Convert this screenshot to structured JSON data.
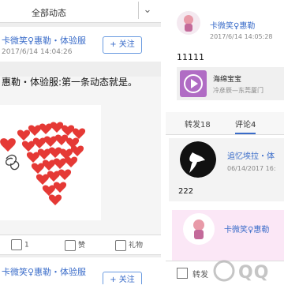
{
  "left": {
    "filter_label": "全部动态",
    "post1": {
      "user": "卡微笑♀惠勒・体验服",
      "time": "2017/6/14 14:04:26",
      "follow": "+ 关注",
      "text": "惠勒・体验服:第一条动态就是。",
      "actions": {
        "comments": "1",
        "like": "赞",
        "gift": "礼物"
      }
    },
    "post2": {
      "user": "卡微笑♀惠勒・体验服",
      "follow": "+ 关注"
    }
  },
  "right": {
    "user": "卡微笑♀惠勒",
    "time": "2017/6/14 14:05:28",
    "content": "11111",
    "share": {
      "title": "海绵宝宝",
      "subtitle": "冷彦辰—东莞厦门"
    },
    "tabs": {
      "repost": "转发18",
      "comment": "评论4"
    },
    "comment": {
      "user": "追忆埃拉・体",
      "time": "06/14/2017 16:",
      "content": "222"
    },
    "pink_user": "卡微笑♀惠勒",
    "bottom_share": "转发"
  },
  "colors": {
    "link": "#3a6cc9",
    "heart": "#e53935"
  },
  "watermark": "QQ"
}
